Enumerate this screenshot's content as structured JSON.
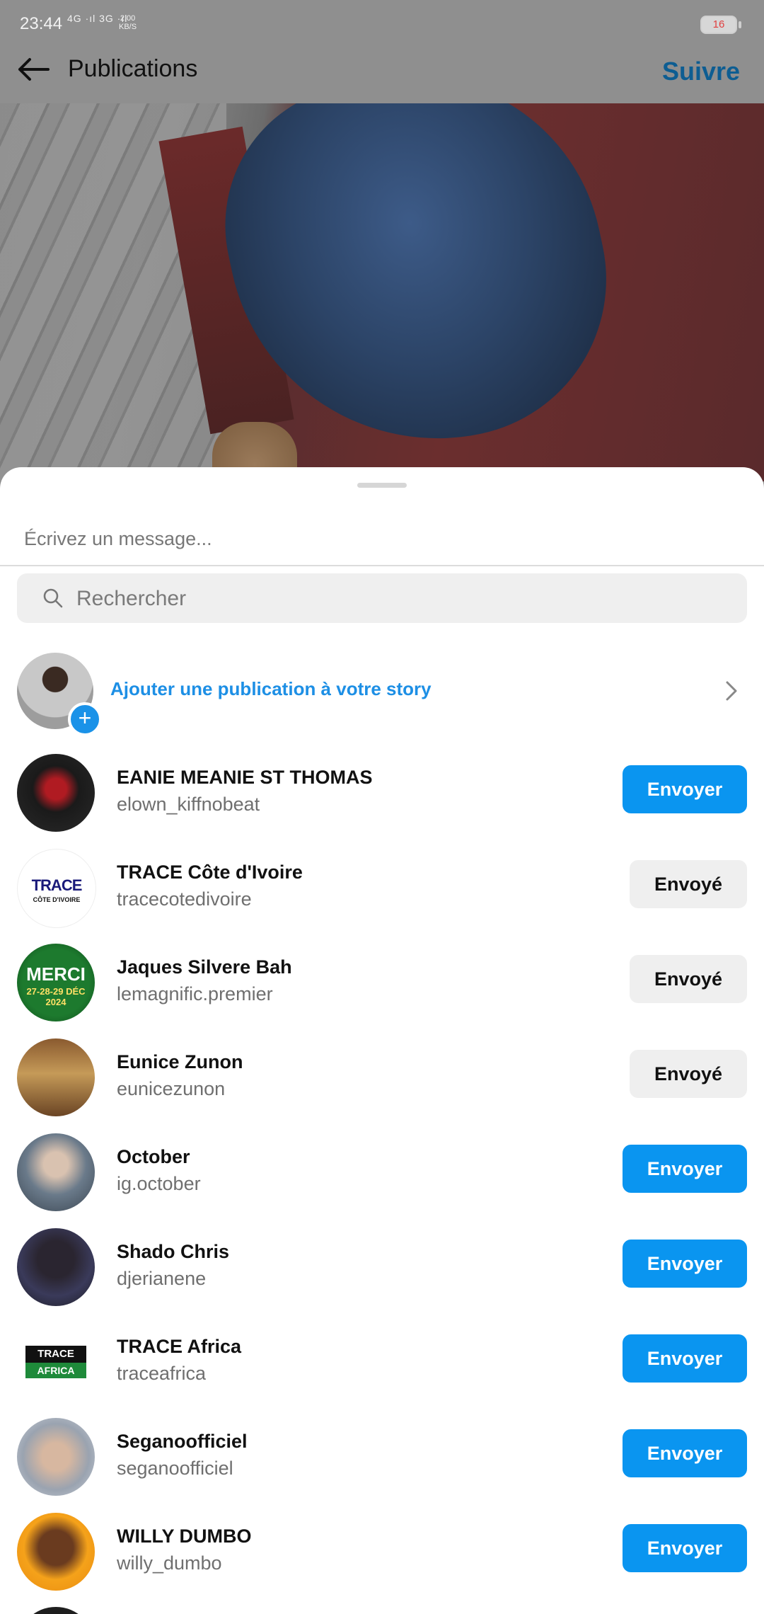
{
  "status_bar": {
    "time": "23:44",
    "network": "4G ·ıl 3G ·ıl",
    "speed_value": "2.00",
    "speed_unit": "KB/S",
    "battery": "16"
  },
  "header": {
    "title": "Publications",
    "follow_label": "Suivre"
  },
  "share_sheet": {
    "message_placeholder": "Écrivez un message...",
    "search_placeholder": "Rechercher",
    "story_label": "Ajouter une publication à votre story",
    "story_plus": "+"
  },
  "contacts": [
    {
      "name": "EANIE MEANIE ST THOMAS",
      "username": "elown_kiffnobeat",
      "action": "Envoyer",
      "state": "send"
    },
    {
      "name": "TRACE Côte d'Ivoire",
      "username": "tracecotedivoire",
      "action": "Envoyé",
      "state": "sent",
      "logo_text": "TRACE",
      "logo_sub": "CÔTE D'IVOIRE"
    },
    {
      "name": "Jaques Silvere Bah",
      "username": "lemagnific.premier",
      "action": "Envoyé",
      "state": "sent",
      "logo_text": "MERCI",
      "logo_sub": "27-28-29 DÉC 2024"
    },
    {
      "name": "Eunice Zunon",
      "username": "eunicezunon",
      "action": "Envoyé",
      "state": "sent"
    },
    {
      "name": "October",
      "username": "ig.october",
      "action": "Envoyer",
      "state": "send"
    },
    {
      "name": "Shado Chris",
      "username": "djerianene",
      "action": "Envoyer",
      "state": "send"
    },
    {
      "name": "TRACE Africa",
      "username": "traceafrica",
      "action": "Envoyer",
      "state": "send",
      "logo_text": "TRACE",
      "logo_sub": "AFRICA"
    },
    {
      "name": "Seganoofficiel",
      "username": "seganoofficiel",
      "action": "Envoyer",
      "state": "send"
    },
    {
      "name": "WILLY DUMBO",
      "username": "willy_dumbo",
      "action": "Envoyer",
      "state": "send"
    }
  ],
  "colors": {
    "accent": "#0a95f0",
    "story_link": "#1d8fe5",
    "follow_dimmed": "#0d5d92"
  },
  "icons": [
    "back-arrow-icon",
    "search-icon",
    "plus-icon",
    "chevron-right-icon"
  ]
}
